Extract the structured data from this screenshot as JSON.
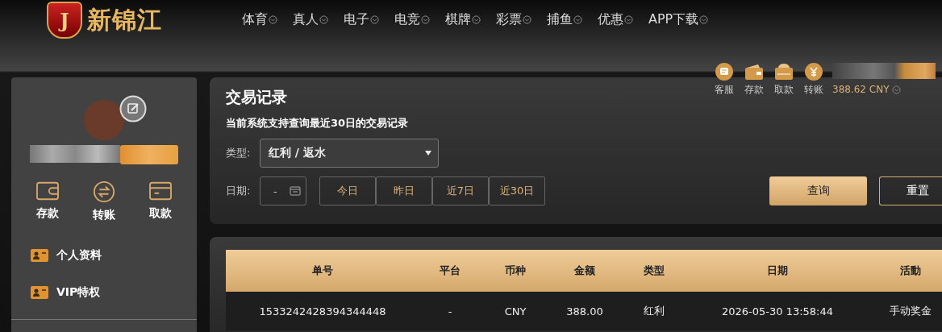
{
  "header": {
    "logo_letter": "J",
    "logo_text": "新锦江",
    "nav": [
      "体育",
      "真人",
      "电子",
      "电竞",
      "棋牌",
      "彩票",
      "捕鱼",
      "优惠",
      "APP下载"
    ]
  },
  "user_bar": {
    "actions": [
      {
        "kind": "chat",
        "label": "客服"
      },
      {
        "kind": "wallet",
        "label": "存款"
      },
      {
        "kind": "card",
        "label": "取款"
      },
      {
        "kind": "yuan",
        "label": "转账"
      }
    ],
    "balance": "388.62 CNY"
  },
  "sidebar": {
    "quick": [
      {
        "kind": "wallet",
        "label": "存款"
      },
      {
        "kind": "transfer",
        "label": "转账"
      },
      {
        "kind": "card",
        "label": "取款"
      }
    ],
    "menu": [
      "个人资料",
      "VIP特权"
    ]
  },
  "page": {
    "title": "交易记录",
    "notice": "当前系统支持查询最近30日的交易记录",
    "type_label": "类型:",
    "type_value": "红利 / 返水",
    "date_label": "日期:",
    "date_value": "-",
    "ranges": [
      {
        "label": "今日",
        "selected": false
      },
      {
        "label": "昨日",
        "selected": false
      },
      {
        "label": "近7日",
        "selected": false
      },
      {
        "label": "近30日",
        "selected": false
      }
    ],
    "search_button": "查询",
    "reset_button": "重置"
  },
  "table": {
    "columns": [
      "单号",
      "平台",
      "币种",
      "金额",
      "类型",
      "日期",
      "活動"
    ],
    "rows": [
      [
        "1533242428394344448",
        "-",
        "CNY",
        "388.00",
        "红利",
        "2026-05-30 13:58:44",
        "手动奖金"
      ]
    ]
  }
}
